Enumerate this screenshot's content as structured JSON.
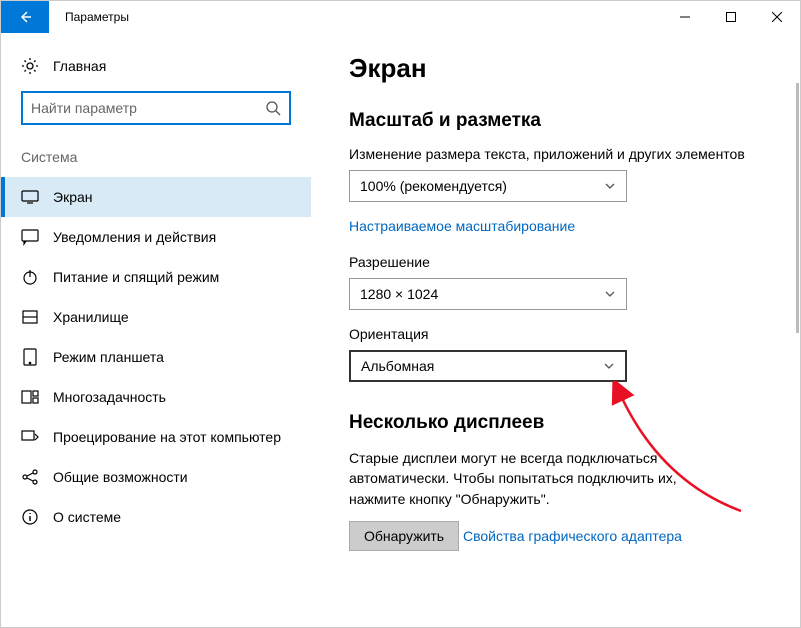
{
  "window": {
    "title": "Параметры"
  },
  "sidebar": {
    "home": "Главная",
    "search_placeholder": "Найти параметр",
    "section": "Система",
    "items": [
      {
        "label": "Экран"
      },
      {
        "label": "Уведомления и действия"
      },
      {
        "label": "Питание и спящий режим"
      },
      {
        "label": "Хранилище"
      },
      {
        "label": "Режим планшета"
      },
      {
        "label": "Многозадачность"
      },
      {
        "label": "Проецирование на этот компьютер"
      },
      {
        "label": "Общие возможности"
      },
      {
        "label": "О системе"
      }
    ]
  },
  "main": {
    "title": "Экран",
    "section_scale": "Масштаб и разметка",
    "scale_label": "Изменение размера текста, приложений и других элементов",
    "scale_value": "100% (рекомендуется)",
    "custom_scaling_link": "Настраиваемое масштабирование",
    "resolution_label": "Разрешение",
    "resolution_value": "1280 × 1024",
    "orientation_label": "Ориентация",
    "orientation_value": "Альбомная",
    "section_multi": "Несколько дисплеев",
    "multi_note": "Старые дисплеи могут не всегда подключаться автоматически. Чтобы попытаться подключить их, нажмите кнопку \"Обнаружить\".",
    "detect_button": "Обнаружить",
    "gpu_link": "Свойства графического адаптера"
  }
}
